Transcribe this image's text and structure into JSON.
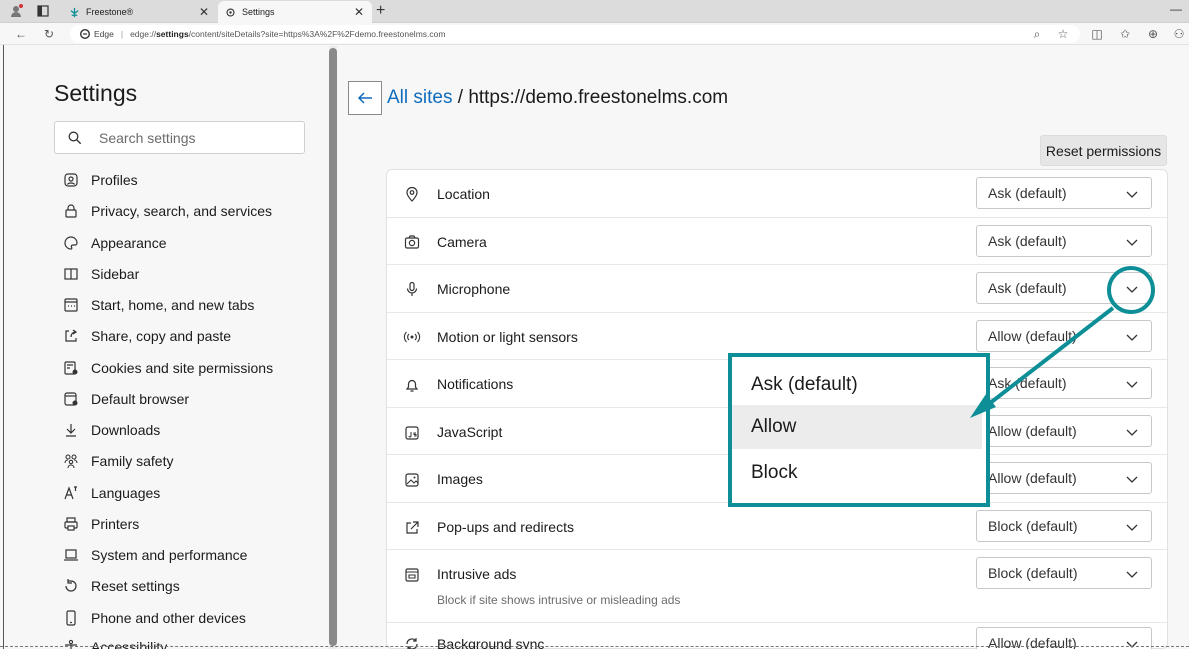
{
  "browser": {
    "tabs": [
      {
        "title": "Freestone®",
        "active": false
      },
      {
        "title": "Settings",
        "active": true
      }
    ],
    "address": {
      "browser_label": "Edge",
      "url_prefix": "edge://",
      "url_bold": "settings",
      "url_rest": "/content/siteDetails?site=https%3A%2F%2Fdemo.freestonelms.com"
    }
  },
  "sidebar": {
    "title": "Settings",
    "search_placeholder": "Search settings",
    "items": [
      {
        "label": "Profiles",
        "icon": "profile-icon"
      },
      {
        "label": "Privacy, search, and services",
        "icon": "lock-icon"
      },
      {
        "label": "Appearance",
        "icon": "palette-icon"
      },
      {
        "label": "Sidebar",
        "icon": "sidebar-icon"
      },
      {
        "label": "Start, home, and new tabs",
        "icon": "home-tabs-icon"
      },
      {
        "label": "Share, copy and paste",
        "icon": "share-icon"
      },
      {
        "label": "Cookies and site permissions",
        "icon": "cookies-icon"
      },
      {
        "label": "Default browser",
        "icon": "browser-icon"
      },
      {
        "label": "Downloads",
        "icon": "download-icon"
      },
      {
        "label": "Family safety",
        "icon": "family-icon"
      },
      {
        "label": "Languages",
        "icon": "language-icon"
      },
      {
        "label": "Printers",
        "icon": "printer-icon"
      },
      {
        "label": "System and performance",
        "icon": "laptop-icon"
      },
      {
        "label": "Reset settings",
        "icon": "reset-icon"
      },
      {
        "label": "Phone and other devices",
        "icon": "phone-icon"
      },
      {
        "label": "Accessibility",
        "icon": "accessibility-icon"
      }
    ]
  },
  "main": {
    "breadcrumb_link": "All sites",
    "breadcrumb_sep": " / ",
    "site": "https://demo.freestonelms.com",
    "reset_label": "Reset permissions",
    "permissions": [
      {
        "label": "Location",
        "value": "Ask (default)",
        "icon": "location-icon"
      },
      {
        "label": "Camera",
        "value": "Ask (default)",
        "icon": "camera-icon"
      },
      {
        "label": "Microphone",
        "value": "Ask (default)",
        "icon": "microphone-icon"
      },
      {
        "label": "Motion or light sensors",
        "value": "Allow (default)",
        "icon": "sensor-icon"
      },
      {
        "label": "Notifications",
        "value": "Ask (default)",
        "icon": "bell-icon"
      },
      {
        "label": "JavaScript",
        "value": "Allow (default)",
        "icon": "javascript-icon"
      },
      {
        "label": "Images",
        "value": "Allow (default)",
        "icon": "image-icon"
      },
      {
        "label": "Pop-ups and redirects",
        "value": "Block (default)",
        "icon": "popup-icon"
      },
      {
        "label": "Intrusive ads",
        "value": "Block (default)",
        "icon": "ads-icon",
        "sub": "Block if site shows intrusive or misleading ads"
      },
      {
        "label": "Background sync",
        "value": "Allow (default)",
        "icon": "sync-icon"
      }
    ]
  },
  "dropdown": {
    "options": [
      {
        "label": "Ask (default)",
        "selected": false
      },
      {
        "label": "Allow",
        "selected": true
      },
      {
        "label": "Block",
        "selected": false
      }
    ]
  },
  "colors": {
    "accent": "#0f6cbd",
    "annotation": "#0e8f97"
  }
}
